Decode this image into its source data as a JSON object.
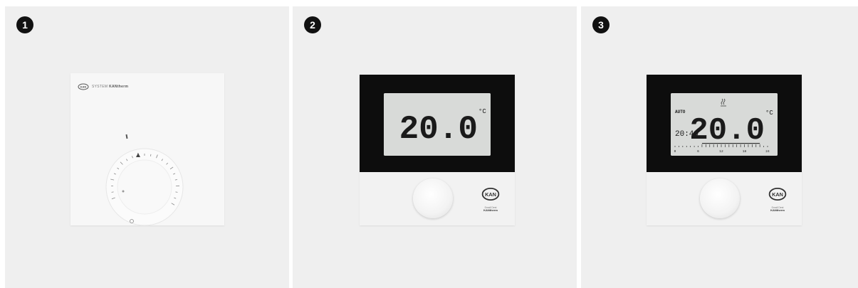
{
  "panels": [
    {
      "badge": "1",
      "device": "analog",
      "brand_line_prefix": "SYSTEM",
      "brand_line_name": "KANtherm"
    },
    {
      "badge": "2",
      "device": "digital",
      "temperature": "20.0",
      "unit": "°C",
      "logo_sub_1": "Small Dest",
      "logo_sub_2": "KANtherm"
    },
    {
      "badge": "3",
      "device": "digital-programmable",
      "mode": "AUTO",
      "time": "20:40",
      "temperature": "20.0",
      "unit": "°C",
      "scale_labels": [
        "0",
        "6",
        "12",
        "18",
        "24"
      ],
      "logo_sub_1": "Small Dest",
      "logo_sub_2": "KANtherm"
    }
  ],
  "logo_text": "KAN",
  "colors": {
    "panel_bg": "#efefef",
    "bezel": "#0d0d0d",
    "lcd": "#d8dad8",
    "badge": "#111111"
  }
}
